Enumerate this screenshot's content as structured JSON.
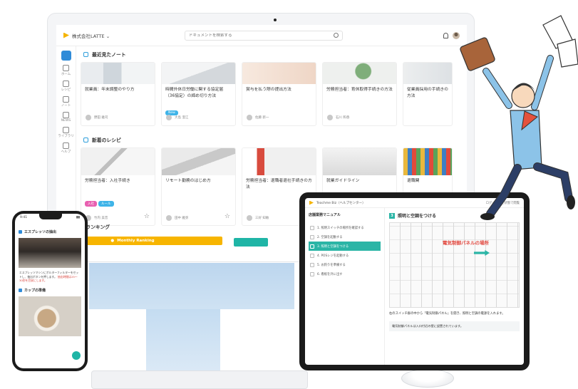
{
  "monitor": {
    "org_name": "株式会社LATTE ⌄",
    "search_placeholder": "ドキュメントを検索する",
    "sidebar": [
      {
        "label": "ホーム"
      },
      {
        "label": "レシピ"
      },
      {
        "label": "ノート"
      },
      {
        "label": "NEWS"
      },
      {
        "label": "ライブラリ"
      },
      {
        "label": "ヘルプ"
      }
    ],
    "section_recent": "最近見たノート",
    "recent_cards": [
      {
        "title": "就業員：年末調整のやり方",
        "author": "野田 雅司"
      },
      {
        "title": "時間外休日労働に関する協定届（36協定）の締め切り方法",
        "author": "大島 澄江",
        "tag": "New"
      },
      {
        "title": "賞与を払う際の提出方法",
        "author": "佐藤 新一"
      },
      {
        "title": "労務担当者：育休取得手続きの方法",
        "author": "石川 和香"
      },
      {
        "title": "従業員採用の手続きの方法",
        "author": ""
      }
    ],
    "section_new": "新着のレシピ",
    "new_cards": [
      {
        "title": "労務担当者：入社手続き",
        "author": "竹内 美音",
        "date": "2023/06/22 ◎80",
        "tags": [
          "入社",
          "ルール"
        ]
      },
      {
        "title": "リモート勤務のはじめ方",
        "author": "田中 雅弥",
        "date": "2023/06/22 ◎80"
      },
      {
        "title": "労務担当者：退職者退社手続きの方法",
        "author": "三好 知敏",
        "date": "2023/06/22 ◎80"
      },
      {
        "title": "就業ガイドライン",
        "author": ""
      },
      {
        "title": "退職関",
        "author": ""
      }
    ],
    "section_ranking": "アクティブユーザーランキング",
    "ranking_bar_label": "Monthly Ranking"
  },
  "phone": {
    "time": "9:41",
    "section1": "エスプレッソの抽出",
    "body_text": "エスプレッソマシンにポルターフィルターをセットし、抽出ボタンを押します。",
    "body_red": "抽出時間は25〜30秒を目安にします。",
    "section2": "カップの準備"
  },
  "tablet": {
    "app_name": "Teachme Biz（ヘルプセンター）",
    "header_right": "ログインした状態で閲覧",
    "toc_title": "店舗業務マニュアル",
    "toc_items": [
      "1. 照明スイッチの場所を確認する",
      "2. 空調を起動する",
      "3. 照明と空調をつける",
      "4. POSレジを起動する",
      "5. お釣りを準備する",
      "6. 看板を外に出す"
    ],
    "active_toc_index": 2,
    "step_number": "3",
    "step_title": "照明と空調をつける",
    "callout": "電気制御パネルの場所",
    "body_text": "右のスイッチ群の中から「電気制御パネル」を開き、照明と空調の電源を入れます。",
    "box_text": "電気制御パネルは入口付近の壁に設置されています。"
  },
  "colors": {
    "accent_blue": "#2f8bd8",
    "teal": "#1fb5a6",
    "ranking_yellow": "#f7b500",
    "tag_pink": "#e85fb0",
    "tag_blue": "#3fb4e8"
  }
}
